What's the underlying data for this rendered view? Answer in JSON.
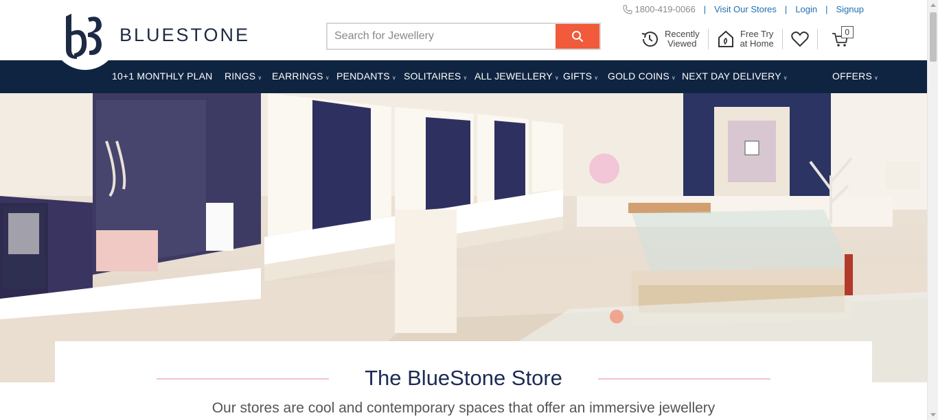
{
  "brand": {
    "name": "BLUESTONE"
  },
  "search": {
    "placeholder": "Search for Jewellery"
  },
  "toplinks": {
    "phone": "1800-419-0066",
    "visit_stores": "Visit Our Stores",
    "login": "Login",
    "signup": "Signup"
  },
  "actions": {
    "recently_viewed": [
      "Recently",
      "Viewed"
    ],
    "free_try": [
      "Free Try",
      "at Home"
    ],
    "cart_count": "0"
  },
  "nav": {
    "items": [
      {
        "label": "10+1 MONTHLY PLAN",
        "has_menu": false
      },
      {
        "label": "RINGS",
        "has_menu": true
      },
      {
        "label": "EARRINGS",
        "has_menu": true
      },
      {
        "label": "PENDANTS",
        "has_menu": true
      },
      {
        "label": "SOLITAIRES",
        "has_menu": true
      },
      {
        "label": "ALL JEWELLERY",
        "has_menu": true
      },
      {
        "label": "GIFTS",
        "has_menu": true
      },
      {
        "label": "GOLD COINS",
        "has_menu": true
      },
      {
        "label": "NEXT DAY DELIVERY",
        "has_menu": true
      },
      {
        "label": "OFFERS",
        "has_menu": true
      }
    ]
  },
  "store": {
    "title": "The BlueStone Store",
    "description": "Our stores are cool and contemporary spaces that offer an immersive jewellery"
  },
  "colors": {
    "nav_bg": "#0f2440",
    "search_btn": "#f15a3b",
    "link": "#1f6fb2",
    "title": "#1c2a55",
    "accent_line": "#f4bfd6"
  }
}
